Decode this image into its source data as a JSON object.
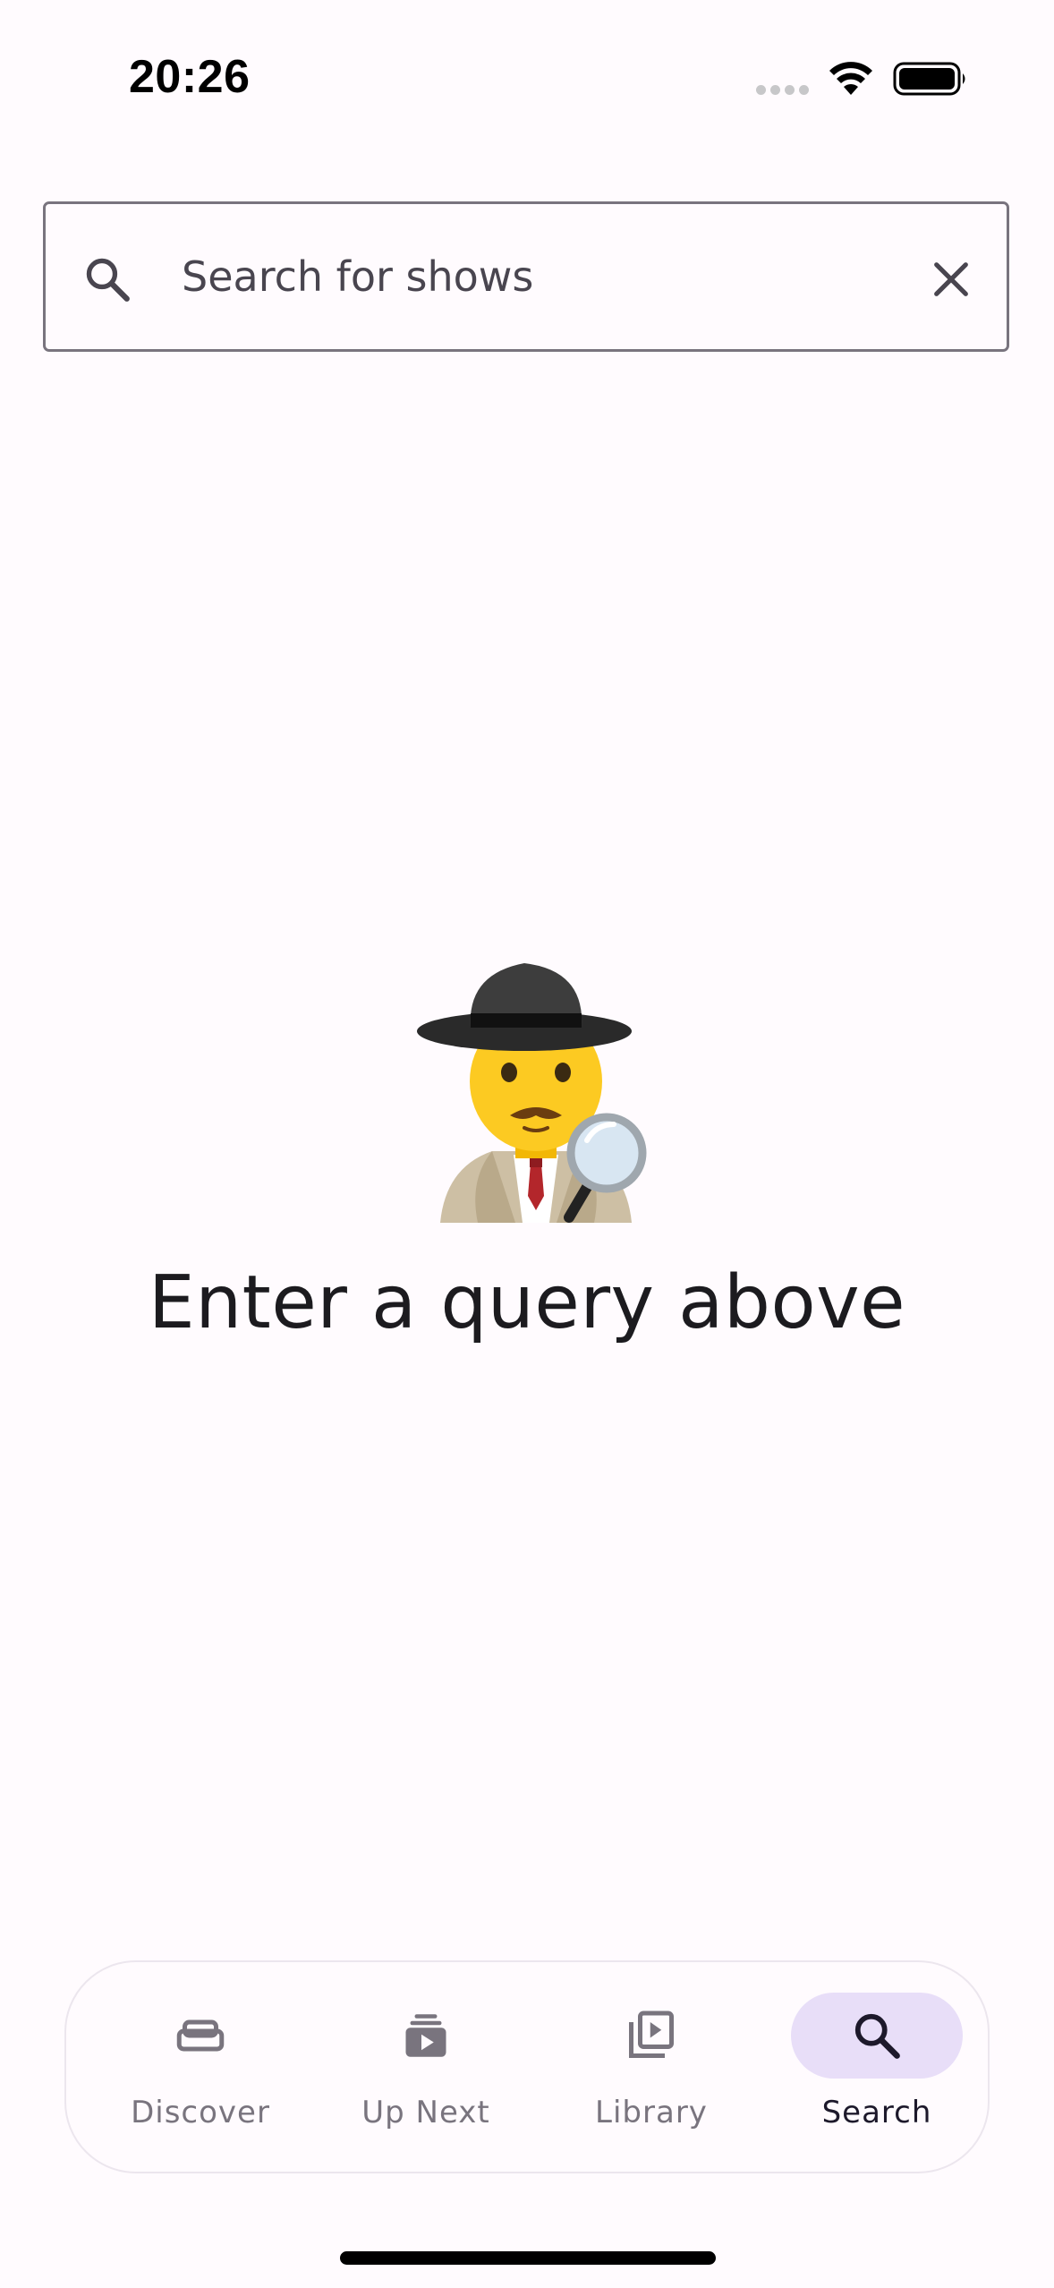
{
  "status_bar": {
    "time": "20:26"
  },
  "search": {
    "placeholder": "Search for shows",
    "value": "",
    "leading_icon": "search-icon",
    "trailing_icon": "close-icon"
  },
  "empty_state": {
    "emoji": "🕵️‍♂️",
    "message": "Enter a query above"
  },
  "bottom_nav": {
    "active_index": 3,
    "items": [
      {
        "label": "Discover",
        "icon": "sofa-icon"
      },
      {
        "label": "Up Next",
        "icon": "play-stack-icon"
      },
      {
        "label": "Library",
        "icon": "video-library-icon"
      },
      {
        "label": "Search",
        "icon": "search-icon"
      }
    ]
  },
  "colors": {
    "background": "#fffbfe",
    "outline": "#79747e",
    "active_indicator": "#e8def8",
    "active_label": "#1d192b",
    "inactive": "#79747e",
    "text": "#1c1b1f"
  }
}
